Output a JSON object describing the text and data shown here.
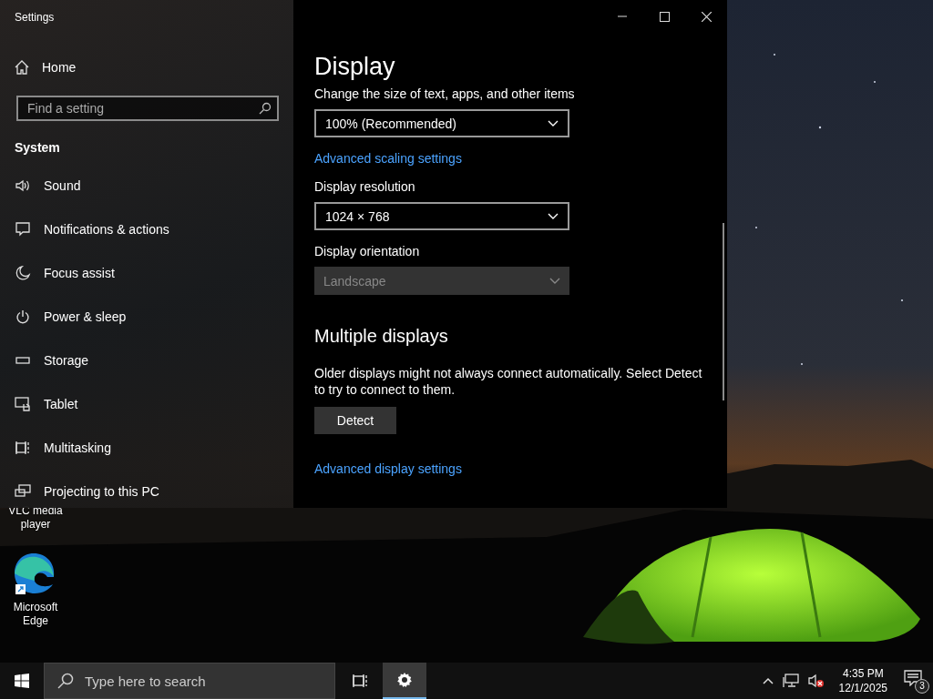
{
  "window": {
    "title": "Settings"
  },
  "sidebar": {
    "home": "Home",
    "search": {
      "placeholder": "Find a setting"
    },
    "section": "System",
    "items": [
      {
        "label": "Sound",
        "kind": "sound"
      },
      {
        "label": "Notifications & actions",
        "kind": "notifications"
      },
      {
        "label": "Focus assist",
        "kind": "moon"
      },
      {
        "label": "Power & sleep",
        "kind": "power"
      },
      {
        "label": "Storage",
        "kind": "storage"
      },
      {
        "label": "Tablet",
        "kind": "tablet"
      },
      {
        "label": "Multitasking",
        "kind": "multitasking"
      },
      {
        "label": "Projecting to this PC",
        "kind": "projecting"
      }
    ]
  },
  "content": {
    "title": "Display",
    "settings": [
      {
        "kind": "dropdown",
        "label": "Change the size of text, apps, and other items",
        "value": "100% (Recommended)",
        "disabled": false
      },
      {
        "kind": "link",
        "label": "Advanced scaling settings"
      },
      {
        "kind": "dropdown",
        "label": "Display resolution",
        "value": "1024 × 768",
        "disabled": false
      },
      {
        "kind": "dropdown",
        "label": "Display orientation",
        "value": "Landscape",
        "disabled": true
      }
    ],
    "multiple_displays": {
      "heading": "Multiple displays",
      "text": "Older displays might not always connect automatically. Select Detect to try to connect to them.",
      "button": "Detect",
      "link": "Advanced display settings"
    }
  },
  "desktop_icons": [
    {
      "label": "VLC media player",
      "kind": "covered"
    },
    {
      "label": "Microsoft Edge",
      "kind": "edge"
    }
  ],
  "taskbar": {
    "search": {
      "placeholder": "Type here to search"
    },
    "apps": [
      {
        "kind": "task-view",
        "selected": false
      },
      {
        "kind": "settings",
        "selected": true
      }
    ],
    "time": "4:35 PM",
    "date": "12/1/2025",
    "notification_count": "3"
  }
}
